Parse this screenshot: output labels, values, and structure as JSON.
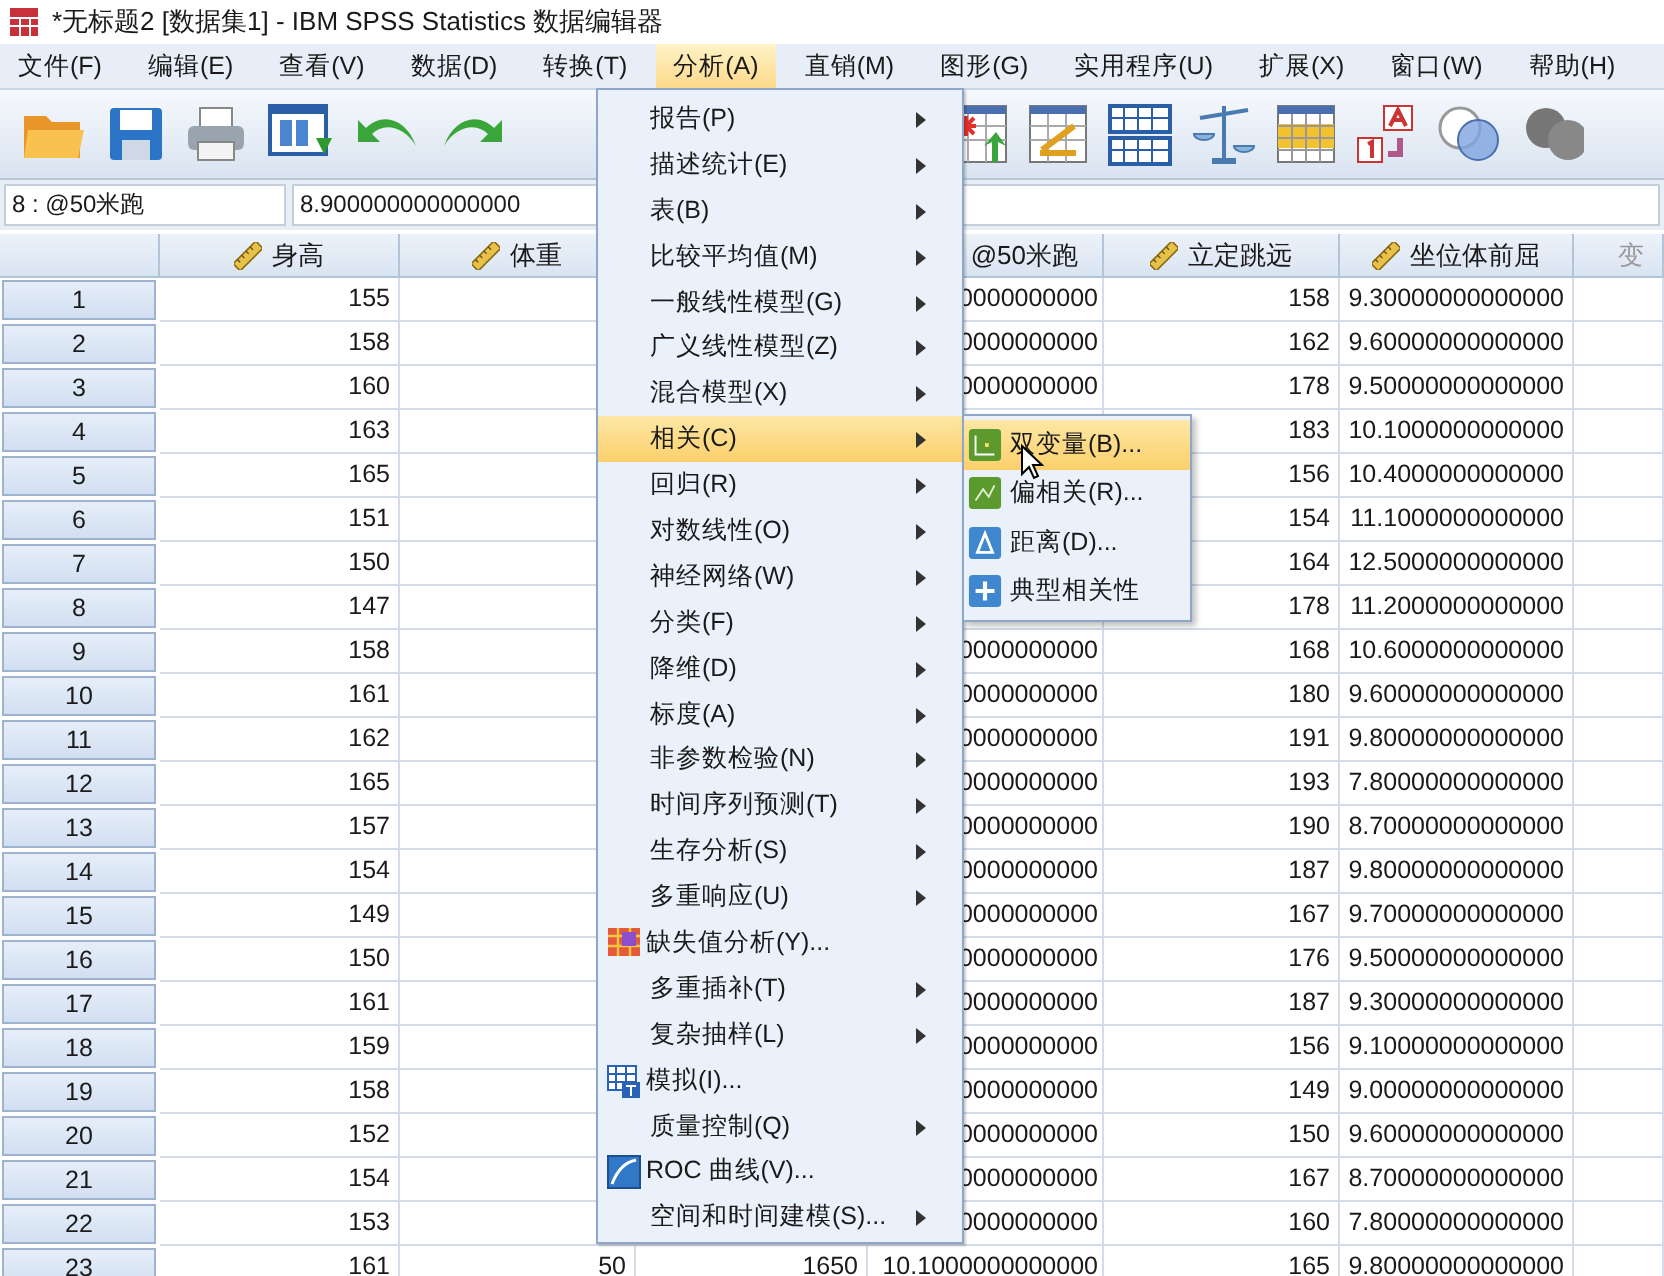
{
  "window": {
    "title": "*无标题2 [数据集1] - IBM SPSS Statistics 数据编辑器"
  },
  "menubar": [
    {
      "label": "文件(F)",
      "selected": false
    },
    {
      "label": "编辑(E)",
      "selected": false
    },
    {
      "label": "查看(V)",
      "selected": false
    },
    {
      "label": "数据(D)",
      "selected": false
    },
    {
      "label": "转换(T)",
      "selected": false
    },
    {
      "label": "分析(A)",
      "selected": true
    },
    {
      "label": "直销(M)",
      "selected": false
    },
    {
      "label": "图形(G)",
      "selected": false
    },
    {
      "label": "实用程序(U)",
      "selected": false
    },
    {
      "label": "扩展(X)",
      "selected": false
    },
    {
      "label": "窗口(W)",
      "selected": false
    },
    {
      "label": "帮助(H)",
      "selected": false
    }
  ],
  "cell_editor": {
    "reference": "8 : @50米跑",
    "value": "8.900000000000000"
  },
  "grid": {
    "columns": [
      {
        "label": "身高",
        "kind": "scale"
      },
      {
        "label": "体重",
        "kind": "scale"
      },
      {
        "kind": "covered"
      },
      {
        "label": "@50米跑",
        "kind": "clipped"
      },
      {
        "label": "立定跳远",
        "kind": "scale"
      },
      {
        "label": "坐位体前屈",
        "kind": "scale"
      },
      {
        "label": "变",
        "kind": "empty"
      }
    ],
    "rows": [
      {
        "number": "1",
        "cells": [
          "155",
          null,
          null,
          "0000000000",
          "158",
          "9.30000000000000"
        ]
      },
      {
        "number": "2",
        "cells": [
          "158",
          null,
          null,
          "0000000000",
          "162",
          "9.60000000000000"
        ]
      },
      {
        "number": "3",
        "cells": [
          "160",
          null,
          null,
          "0000000000",
          "178",
          "9.50000000000000"
        ]
      },
      {
        "number": "4",
        "cells": [
          "163",
          null,
          null,
          null,
          "183",
          "10.1000000000000"
        ]
      },
      {
        "number": "5",
        "cells": [
          "165",
          null,
          null,
          null,
          "156",
          "10.4000000000000"
        ]
      },
      {
        "number": "6",
        "cells": [
          "151",
          null,
          null,
          null,
          "154",
          "11.1000000000000"
        ]
      },
      {
        "number": "7",
        "cells": [
          "150",
          null,
          null,
          null,
          "164",
          "12.5000000000000"
        ]
      },
      {
        "number": "8",
        "cells": [
          "147",
          null,
          null,
          null,
          "178",
          "11.2000000000000"
        ]
      },
      {
        "number": "9",
        "cells": [
          "158",
          null,
          null,
          "0000000000",
          "168",
          "10.6000000000000"
        ]
      },
      {
        "number": "10",
        "cells": [
          "161",
          null,
          null,
          "0000000000",
          "180",
          "9.60000000000000"
        ]
      },
      {
        "number": "11",
        "cells": [
          "162",
          null,
          null,
          "0000000000",
          "191",
          "9.80000000000000"
        ]
      },
      {
        "number": "12",
        "cells": [
          "165",
          null,
          null,
          "0000000000",
          "193",
          "7.80000000000000"
        ]
      },
      {
        "number": "13",
        "cells": [
          "157",
          null,
          null,
          "0000000000",
          "190",
          "8.70000000000000"
        ]
      },
      {
        "number": "14",
        "cells": [
          "154",
          null,
          null,
          "0000000000",
          "187",
          "9.80000000000000"
        ]
      },
      {
        "number": "15",
        "cells": [
          "149",
          null,
          null,
          "0000000000",
          "167",
          "9.70000000000000"
        ]
      },
      {
        "number": "16",
        "cells": [
          "150",
          null,
          null,
          "0000000000",
          "176",
          "9.50000000000000"
        ]
      },
      {
        "number": "17",
        "cells": [
          "161",
          null,
          null,
          "0000000000",
          "187",
          "9.30000000000000"
        ]
      },
      {
        "number": "18",
        "cells": [
          "159",
          null,
          null,
          "0000000000",
          "156",
          "9.10000000000000"
        ]
      },
      {
        "number": "19",
        "cells": [
          "158",
          null,
          null,
          "0000000000",
          "149",
          "9.00000000000000"
        ]
      },
      {
        "number": "20",
        "cells": [
          "152",
          null,
          null,
          "0000000000",
          "150",
          "9.60000000000000"
        ]
      },
      {
        "number": "21",
        "cells": [
          "154",
          null,
          null,
          "0000000000",
          "167",
          "8.70000000000000"
        ]
      },
      {
        "number": "22",
        "cells": [
          "153",
          null,
          null,
          "0000000000",
          "160",
          "7.80000000000000"
        ]
      },
      {
        "number": "23",
        "cells": [
          "161",
          "50",
          "1650",
          "10.1000000000000",
          "165",
          "9.80000000000000"
        ]
      }
    ]
  },
  "analyze_menu": [
    {
      "label": "报告(P)",
      "kind": "submenu",
      "selected": false
    },
    {
      "label": "描述统计(E)",
      "kind": "submenu",
      "selected": false
    },
    {
      "label": "表(B)",
      "kind": "submenu",
      "selected": false
    },
    {
      "label": "比较平均值(M)",
      "kind": "submenu",
      "selected": false
    },
    {
      "label": "一般线性模型(G)",
      "kind": "submenu",
      "selected": false
    },
    {
      "label": "广义线性模型(Z)",
      "kind": "submenu",
      "selected": false
    },
    {
      "label": "混合模型(X)",
      "kind": "submenu",
      "selected": false
    },
    {
      "label": "相关(C)",
      "kind": "submenu",
      "selected": true
    },
    {
      "label": "回归(R)",
      "kind": "submenu",
      "selected": false
    },
    {
      "label": "对数线性(O)",
      "kind": "submenu",
      "selected": false
    },
    {
      "label": "神经网络(W)",
      "kind": "submenu",
      "selected": false
    },
    {
      "label": "分类(F)",
      "kind": "submenu",
      "selected": false
    },
    {
      "label": "降维(D)",
      "kind": "submenu",
      "selected": false
    },
    {
      "label": "标度(A)",
      "kind": "submenu",
      "selected": false
    },
    {
      "label": "非参数检验(N)",
      "kind": "submenu",
      "selected": false
    },
    {
      "label": "时间序列预测(T)",
      "kind": "submenu",
      "selected": false
    },
    {
      "label": "生存分析(S)",
      "kind": "submenu",
      "selected": false
    },
    {
      "label": "多重响应(U)",
      "kind": "submenu",
      "selected": false
    },
    {
      "label": "缺失值分析(Y)...",
      "kind": "dialog",
      "selected": false
    },
    {
      "label": "多重插补(T)",
      "kind": "submenu",
      "selected": false
    },
    {
      "label": "复杂抽样(L)",
      "kind": "submenu",
      "selected": false
    },
    {
      "label": "模拟(I)...",
      "kind": "dialog",
      "selected": false
    },
    {
      "label": "质量控制(Q)",
      "kind": "submenu",
      "selected": false
    },
    {
      "label": "ROC 曲线(V)...",
      "kind": "dialog",
      "selected": false
    },
    {
      "label": "空间和时间建模(S)...",
      "kind": "submenu",
      "selected": false
    }
  ],
  "correlate_submenu": [
    {
      "label": "双变量(B)...",
      "selected": true
    },
    {
      "label": "偏相关(R)...",
      "selected": false
    },
    {
      "label": "距离(D)...",
      "selected": false
    },
    {
      "label": "典型相关性",
      "selected": false
    }
  ]
}
